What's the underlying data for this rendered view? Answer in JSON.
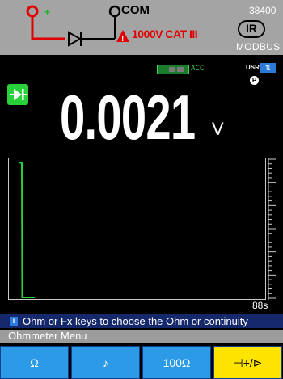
{
  "banner": {
    "com_label": "COM",
    "cat_label": "1000V CAT III",
    "ir_label": "IR",
    "model": "38400",
    "protocol": "MODBUS",
    "colors": {
      "background": "#a4a4a4",
      "lead_red": "#e00000",
      "plus_green": "#15b72a"
    }
  },
  "status": {
    "acc_label": "ACC",
    "usr_label": "USR",
    "usr_icon": "arrows-icon",
    "p_label": "P"
  },
  "measurement": {
    "mode_icon": "diode-icon",
    "value": "0.0021",
    "unit": "V"
  },
  "graph": {
    "time_label": "88s",
    "trace_color": "#27d33a",
    "series": [
      {
        "t": 0,
        "level": 0.98
      },
      {
        "t": 0.04,
        "level": 0.98
      },
      {
        "t": 0.045,
        "level": 0.0
      },
      {
        "t": 0.2,
        "level": 0.0
      }
    ]
  },
  "info": {
    "icon": "info-icon",
    "text": "Ohm or Fx keys to choose the Ohm or continuity"
  },
  "menu": {
    "title": "Ohmmeter Menu",
    "keys": [
      {
        "label": "Ω",
        "selected": false
      },
      {
        "label": "♪",
        "selected": false
      },
      {
        "label": "100Ω",
        "selected": false
      },
      {
        "label": "⊣+/⊳",
        "selected": true
      }
    ]
  }
}
